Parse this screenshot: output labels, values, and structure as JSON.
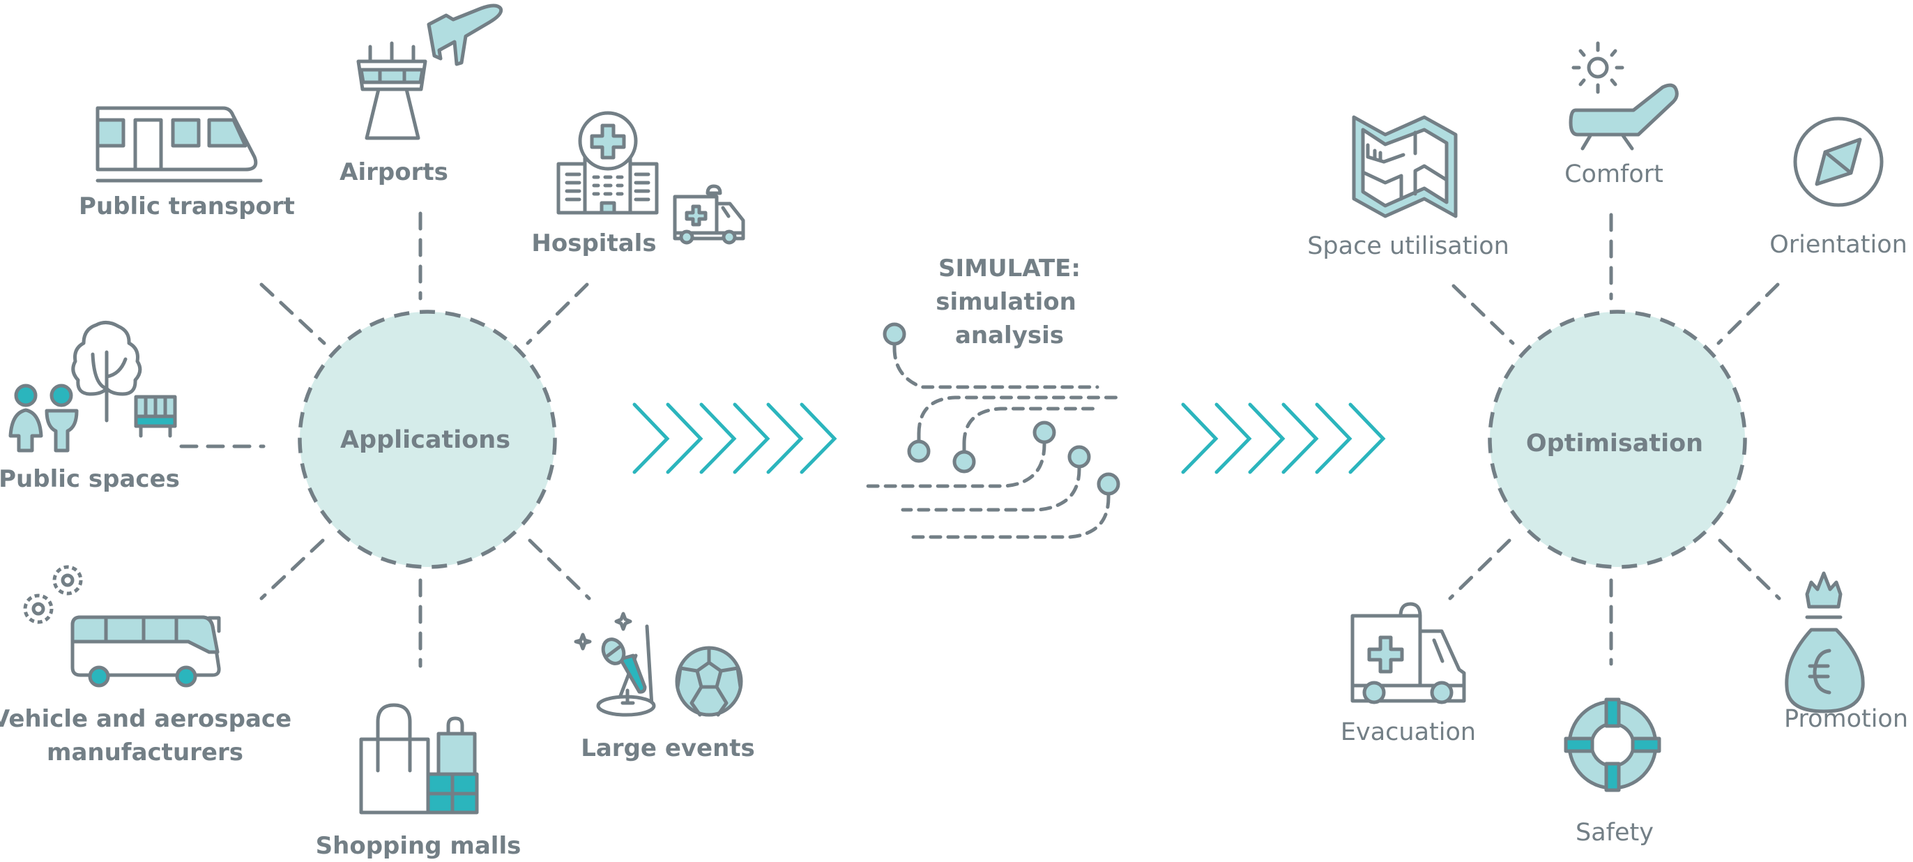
{
  "colors": {
    "gray": "#737f86",
    "light_teal": "#b1dde0",
    "hub_fill": "#d5ecea",
    "accent_teal": "#2bb5bd",
    "background": "#ffffff"
  },
  "applications": {
    "hub_label": "Applications",
    "items": [
      {
        "id": "public-transport",
        "label": "Public transport",
        "icon": "train-icon"
      },
      {
        "id": "airports",
        "label": "Airports",
        "icon": "control-tower-airplane-icon"
      },
      {
        "id": "hospitals",
        "label": "Hospitals",
        "icon": "hospital-ambulance-icon"
      },
      {
        "id": "public-spaces",
        "label": "Public spaces",
        "icon": "people-tree-bench-icon"
      },
      {
        "id": "vehicle-aerospace",
        "label_lines": [
          "Vehicle and aerospace",
          "manufacturers"
        ],
        "icon": "bus-gears-icon"
      },
      {
        "id": "shopping-malls",
        "label": "Shopping malls",
        "icon": "shopping-bags-icon"
      },
      {
        "id": "large-events",
        "label": "Large events",
        "icon": "microphone-football-icon"
      }
    ]
  },
  "simulate": {
    "title": "SIMULATE:",
    "lines": [
      "simulation",
      "analysis"
    ],
    "icon": "agent-paths-icon"
  },
  "flow_arrows": {
    "icon": "chevrons-right-icon",
    "count": 6
  },
  "optimisation": {
    "hub_label": "Optimisation",
    "items": [
      {
        "id": "space-utilisation",
        "label": "Space utilisation",
        "icon": "map-icon"
      },
      {
        "id": "comfort",
        "label": "Comfort",
        "icon": "sun-lounger-icon"
      },
      {
        "id": "orientation",
        "label": "Orientation",
        "icon": "compass-icon"
      },
      {
        "id": "evacuation",
        "label": "Evacuation",
        "icon": "ambulance-icon"
      },
      {
        "id": "safety",
        "label": "Safety",
        "icon": "lifebuoy-icon"
      },
      {
        "id": "promotion",
        "label": "Promotion",
        "icon": "money-bag-euro-icon"
      }
    ]
  }
}
